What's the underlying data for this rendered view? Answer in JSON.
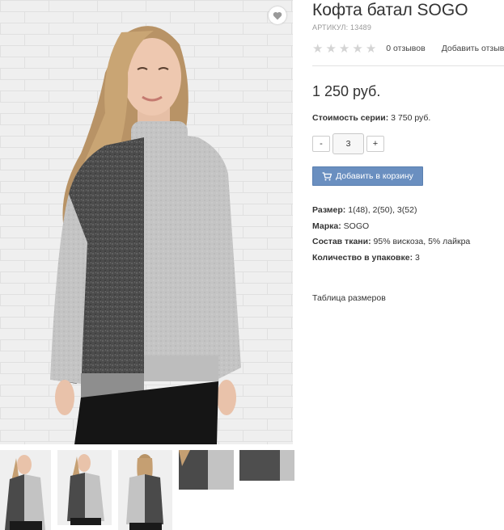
{
  "product": {
    "title": "Кофта батал SOGO",
    "sku": "АРТИКУЛ: 13489",
    "rating_stars": 0,
    "rating_max": 5,
    "reviews_label": "0 отзывов",
    "add_review_label": "Добавить отзыв",
    "price": "1 250 руб.",
    "series_label": "Стоимость серии:",
    "series_value": "3 750 руб.",
    "quantity": "3",
    "minus_label": "-",
    "plus_label": "+",
    "add_to_cart_label": "Добавить в корзину",
    "attributes": [
      {
        "label": "Размер:",
        "value": "1(48), 2(50), 3(52)"
      },
      {
        "label": "Марка:",
        "value": "SOGO"
      },
      {
        "label": "Состав ткани:",
        "value": "95% вискоза, 5% лайкра"
      },
      {
        "label": "Количество в упаковке:",
        "value": "3"
      }
    ],
    "size_table_label": "Таблица размеров"
  },
  "icons": {
    "favorite": "heart-icon",
    "cart": "cart-icon",
    "star": "star-icon"
  },
  "colors": {
    "cart_button": "#6a8fc0",
    "star_empty": "#d4d4d4",
    "dark_panel": "#4a4a4a",
    "light_panel": "#c3c3c3"
  }
}
